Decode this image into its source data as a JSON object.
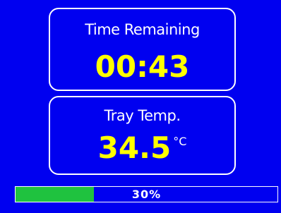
{
  "colors": {
    "background": "#0000f0",
    "value_text": "#ffff00",
    "label_text": "#ffffff",
    "progress_fill": "#1fc23f"
  },
  "time_panel": {
    "label": "Time Remaining",
    "value": "00:43"
  },
  "temp_panel": {
    "label": "Tray Temp.",
    "value": "34.5",
    "unit": "°C"
  },
  "progress": {
    "percent": 30,
    "label": "30%"
  }
}
